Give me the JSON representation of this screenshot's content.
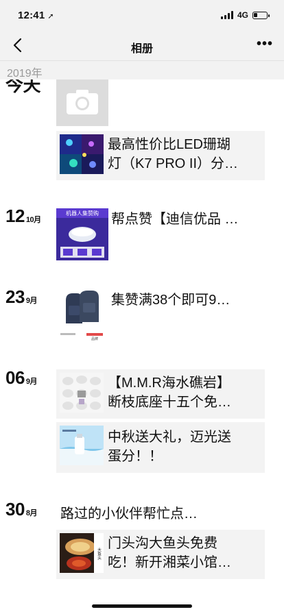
{
  "status": {
    "time": "12:41",
    "network": "4G",
    "battery_level": 0.3
  },
  "nav": {
    "title": "相册",
    "more": "•••"
  },
  "year": "2019年",
  "entries": [
    {
      "day": "今天",
      "month": ""
    },
    {
      "day": "12",
      "month": "10月"
    },
    {
      "day": "23",
      "month": "9月"
    },
    {
      "day": "06",
      "month": "9月"
    },
    {
      "day": "30",
      "month": "8月"
    }
  ],
  "posts": {
    "p1": {
      "line1": "最高性价比LED珊瑚",
      "line2": "灯（K7 PRO II）分…"
    },
    "p2": {
      "line1": "帮点赞【迪信优品 …"
    },
    "p3": {
      "line1": "集赞满38个即可9…"
    },
    "p4": {
      "line1": "【M.M.R海水礁岩】",
      "line2": "断枝底座十五个免…"
    },
    "p5": {
      "line1": "中秋送大礼，迈光送",
      "line2": "蛋分！！"
    },
    "p6": {
      "line1": "路过的小伙伴帮忙点…"
    },
    "p7": {
      "line1": "门头沟大鱼头免费",
      "line2": "吃！新开湘菜小馆…"
    }
  },
  "thumb_text": {
    "robot_title": "机器人集赞购",
    "bag_brand": "品牌",
    "food_label": "大鱼头"
  }
}
